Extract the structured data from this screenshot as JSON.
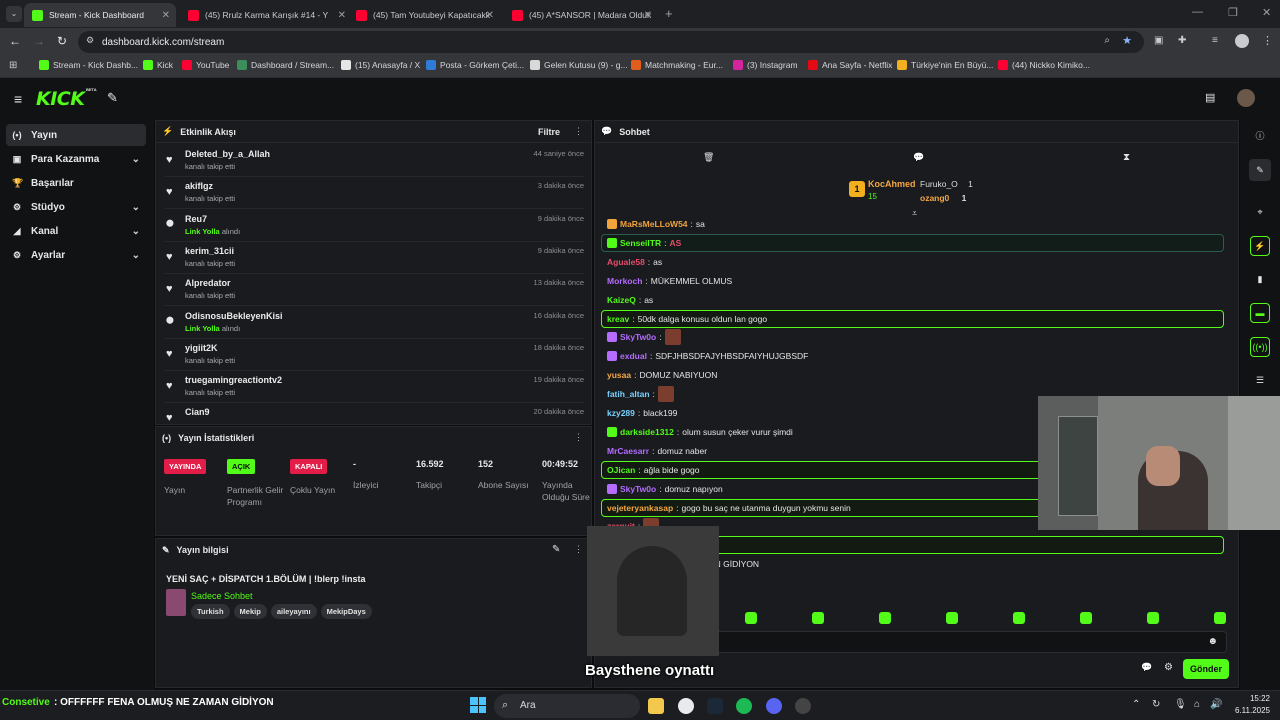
{
  "browser": {
    "tabs": [
      {
        "title": "Stream - Kick Dashboard",
        "active": true,
        "fav": "#53fc18"
      },
      {
        "title": "(45) Rrulz Karma Karışık #14 - Y",
        "active": false,
        "fav": "#ff0033"
      },
      {
        "title": "(45) Tam Youtubeyi Kapatıcakk",
        "active": false,
        "fav": "#ff0033"
      },
      {
        "title": "(45) A*SANSOR | Madara Olduk",
        "active": false,
        "fav": "#ff0033"
      }
    ],
    "new_tab": "+",
    "url": "dashboard.kick.com/stream",
    "bookmarks": [
      {
        "label": "Stream - Kick Dashb...",
        "color": "#53fc18"
      },
      {
        "label": "Kick",
        "color": "#53fc18"
      },
      {
        "label": "YouTube",
        "color": "#ff0033"
      },
      {
        "label": "Dashboard / Stream...",
        "color": "#3a8f5a"
      },
      {
        "label": "(15) Anasayfa / X",
        "color": "#e6e6e6"
      },
      {
        "label": "Posta - Görkem Çeti...",
        "color": "#2f7bd8"
      },
      {
        "label": "Gelen Kutusu (9) - g...",
        "color": "#d9d9d9"
      },
      {
        "label": "Matchmaking - Eur...",
        "color": "#e05d1c"
      },
      {
        "label": "(3) Instagram",
        "color": "#d6249f"
      },
      {
        "label": "Ana Sayfa - Netflix",
        "color": "#e50914"
      },
      {
        "label": "Türkiye'nin En Büyü...",
        "color": "#f2b01e"
      },
      {
        "label": "(44) Nickko Kimiko...",
        "color": "#ff0033"
      }
    ]
  },
  "kick": {
    "logo": "KICK",
    "beta": "BETA",
    "accent": "#53fc18"
  },
  "sidebar": {
    "items": [
      {
        "label": "Yayın",
        "icon": "(•)",
        "chev": false,
        "active": true
      },
      {
        "label": "Para Kazanma",
        "icon": "▣",
        "chev": true,
        "active": false
      },
      {
        "label": "Başarılar",
        "icon": "🏆",
        "chev": false,
        "active": false
      },
      {
        "label": "Stüdyo",
        "icon": "⚙",
        "chev": true,
        "active": false
      },
      {
        "label": "Kanal",
        "icon": "◢",
        "chev": true,
        "active": false
      },
      {
        "label": "Ayarlar",
        "icon": "⚙",
        "chev": true,
        "active": false
      }
    ]
  },
  "activity": {
    "title": "Etkinlik Akışı",
    "filter": "Filtre",
    "items": [
      {
        "name": "Deleted_by_a_Allah",
        "sub": "kanalı takip etti",
        "link": "",
        "time": "44 saniye önce",
        "icon": "♥"
      },
      {
        "name": "akiflgz",
        "sub": "kanalı takip etti",
        "link": "",
        "time": "3 dakika önce",
        "icon": "♥"
      },
      {
        "name": "Reu7",
        "sub": "alındı",
        "link": "Link Yolla",
        "time": "9 dakika önce",
        "icon": "⬤"
      },
      {
        "name": "kerim_31cii",
        "sub": "kanalı takip etti",
        "link": "",
        "time": "9 dakika önce",
        "icon": "♥"
      },
      {
        "name": "Alpredator",
        "sub": "kanalı takip etti",
        "link": "",
        "time": "13 dakika önce",
        "icon": "♥"
      },
      {
        "name": "OdisnosuBekleyenKisi",
        "sub": "alındı",
        "link": "Link Yolla",
        "time": "16 dakika önce",
        "icon": "⬤"
      },
      {
        "name": "yigiit2K",
        "sub": "kanalı takip etti",
        "link": "",
        "time": "18 dakika önce",
        "icon": "♥"
      },
      {
        "name": "truegamingreactiontv2",
        "sub": "kanalı takip etti",
        "link": "",
        "time": "19 dakika önce",
        "icon": "♥"
      },
      {
        "name": "Cian9",
        "sub": "",
        "link": "",
        "time": "20 dakika önce",
        "icon": "♥"
      }
    ]
  },
  "stats": {
    "title": "Yayın İstatistikleri",
    "cols": [
      {
        "value": "YAYINDA",
        "label": "Yayın",
        "badge": "#e11d48",
        "badge_text": "#ffffff"
      },
      {
        "value": "AÇIK",
        "label": "Partnerlik Gelir Programı",
        "badge": "#53fc18",
        "badge_text": "#0b0c0e"
      },
      {
        "value": "KAPALI",
        "label": "Çoklu Yayın",
        "badge": "#e11d48",
        "badge_text": "#ffffff"
      },
      {
        "value": "-",
        "label": "İzleyici",
        "badge": "",
        "badge_text": ""
      },
      {
        "value": "16.592",
        "label": "Takipçi",
        "badge": "",
        "badge_text": ""
      },
      {
        "value": "152",
        "label": "Abone Sayısı",
        "badge": "",
        "badge_text": ""
      },
      {
        "value": "00:49:52",
        "label": "Yayında Olduğu Süre",
        "badge": "",
        "badge_text": ""
      }
    ]
  },
  "info": {
    "title": "Yayın bilgisi",
    "stream_title": "YENİ SAÇ + DİSPATCH 1.BÖLÜM | !blerp !insta",
    "category": "Sadece Sohbet",
    "tags": [
      "Turkish",
      "Mekip",
      "aileyayını",
      "MekipDays"
    ]
  },
  "chat": {
    "title": "Sohbet",
    "pinned": {
      "user": "KocAhmed",
      "rank": "1",
      "count": "15",
      "others": [
        {
          "name": "Furuko_O",
          "n": "1"
        },
        {
          "name": "ozang0",
          "n": "1"
        }
      ]
    },
    "messages": [
      {
        "user": "MaRsMeLLoW54",
        "color": "#f1a33c",
        "text": "sa",
        "hl": false,
        "icon": true
      },
      {
        "user": "SenseiITR",
        "color": "#53fc18",
        "text": "AS",
        "hl": "blue",
        "icon": true,
        "redtext": true
      },
      {
        "user": "Aguale58",
        "color": "#e84c6b",
        "text": "as",
        "hl": false,
        "icon": false
      },
      {
        "user": "Morkoch",
        "color": "#b56cff",
        "text": "MÜKEMMEL OLMUS",
        "hl": false,
        "icon": false
      },
      {
        "user": "KaizeQ",
        "color": "#53fc18",
        "text": "as",
        "hl": false,
        "icon": false
      },
      {
        "user": "kreav",
        "color": "#53fc18",
        "text": "50dk dalga konusu oldun lan gogo",
        "hl": "green",
        "icon": false
      },
      {
        "user": "SkyTw0o",
        "color": "#b56cff",
        "text": "",
        "hl": false,
        "icon": true,
        "emote": true
      },
      {
        "user": "exdual",
        "color": "#b56cff",
        "text": "SDFJHBSDFAJYHBSDFAIYHUJGBSDF",
        "hl": false,
        "icon": true
      },
      {
        "user": "yusaa",
        "color": "#f5a742",
        "text": "DOMUZ NABIYUON",
        "hl": false,
        "icon": false
      },
      {
        "user": "fatih_altan",
        "color": "#7ad0ff",
        "text": "",
        "hl": false,
        "icon": false,
        "emote": true
      },
      {
        "user": "kzy289",
        "color": "#7ad0ff",
        "text": "black199",
        "hl": false,
        "icon": false
      },
      {
        "user": "darkside1312",
        "color": "#53fc18",
        "text": "olum susun çeker vurur şimdi",
        "hl": false,
        "icon": true
      },
      {
        "user": "MrCaesarr",
        "color": "#b56cff",
        "text": "domuz naber",
        "hl": false,
        "icon": false
      },
      {
        "user": "OJican",
        "color": "#53fc18",
        "text": "ağla bide gogo",
        "hl": "green",
        "icon": false
      },
      {
        "user": "SkyTw0o",
        "color": "#b56cff",
        "text": "domuz napıyon",
        "hl": false,
        "icon": true
      },
      {
        "user": "vejeteryankasap",
        "color": "#f5a742",
        "text": "gogo bu saç ne utanma duygun yokmu senin",
        "hl": "green",
        "icon": false
      },
      {
        "user": "zerquit",
        "color": "#e84c6b",
        "text": "",
        "hl": false,
        "icon": false,
        "emote": true
      },
      {
        "user": "",
        "color": "#53fc18",
        "text": "saçrş olmuş aq @Gogo",
        "hl": "green",
        "icon": false
      },
      {
        "user": "",
        "color": "#e6e6e6",
        "text": "FF FENA OLMUŞ NE ZAMAN GİDİYON",
        "hl": false,
        "icon": false
      }
    ],
    "send": "Gönder",
    "toolbar_icons": [
      "trash-icon",
      "chat-icon",
      "hourglass-icon"
    ]
  },
  "overlay": {
    "caption": "Baysthene oynattı"
  },
  "ticker": {
    "user": "Consetive",
    "text": ": OFFFFFF FENA OLMUŞ NE ZAMAN GİDİYON"
  },
  "taskbar": {
    "search": "Ara",
    "time": "15:22",
    "date": "6.11.2025"
  }
}
